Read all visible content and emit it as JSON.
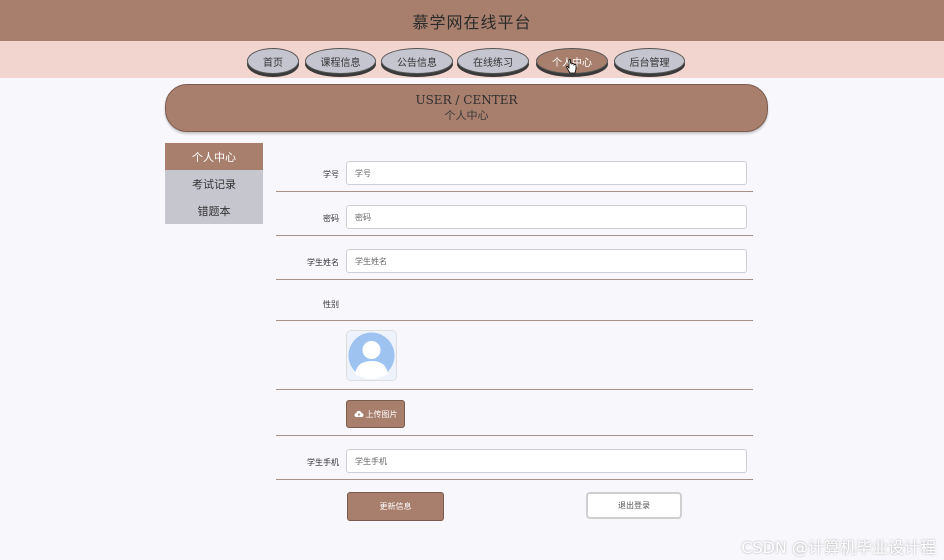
{
  "header": {
    "title": "慕学网在线平台"
  },
  "nav": {
    "items": [
      {
        "label": "首页"
      },
      {
        "label": "课程信息"
      },
      {
        "label": "公告信息"
      },
      {
        "label": "在线练习"
      },
      {
        "label": "个人中心",
        "active": true
      },
      {
        "label": "后台管理"
      }
    ]
  },
  "hero": {
    "en": "USER / CENTER",
    "cn": "个人中心"
  },
  "sidebar": {
    "items": [
      {
        "label": "个人中心",
        "active": true
      },
      {
        "label": "考试记录"
      },
      {
        "label": "错题本"
      }
    ]
  },
  "form": {
    "student_no": {
      "label": "学号",
      "placeholder": "学号"
    },
    "password": {
      "label": "密码",
      "placeholder": "密码"
    },
    "student_name": {
      "label": "学生姓名",
      "placeholder": "学生姓名"
    },
    "gender": {
      "label": "性别"
    },
    "phone": {
      "label": "学生手机",
      "placeholder": "学生手机"
    },
    "upload_label": "上传图片",
    "update_label": "更新信息",
    "logout_label": "退出登录"
  },
  "watermark": "CSDN @计算机毕业设计程",
  "colors": {
    "accent": "#a87f6c",
    "nav_bg": "#f3d5d0",
    "menu_bg": "#c6c6ce"
  },
  "icons": [
    "avatar-placeholder-icon",
    "cloud-upload-icon",
    "hand-cursor-icon"
  ]
}
